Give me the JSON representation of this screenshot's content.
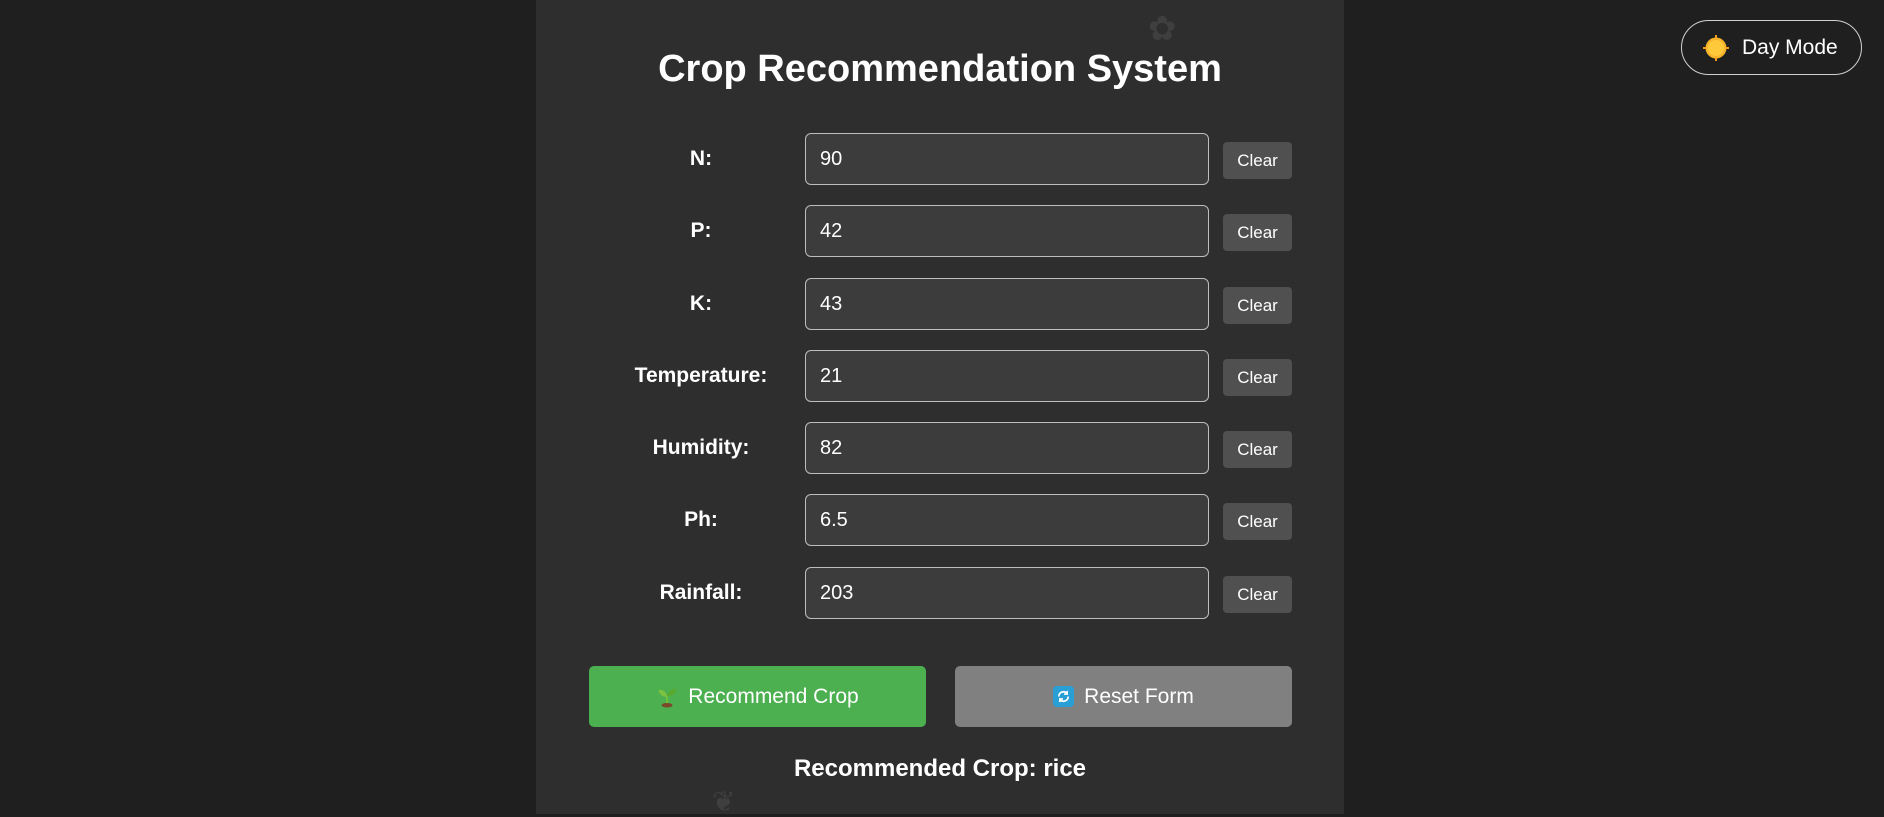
{
  "header": {
    "title": "Crop Recommendation System"
  },
  "fields": [
    {
      "label": "N:",
      "value": "90",
      "clear_label": "Clear"
    },
    {
      "label": "P:",
      "value": "42",
      "clear_label": "Clear"
    },
    {
      "label": "K:",
      "value": "43",
      "clear_label": "Clear"
    },
    {
      "label": "Temperature:",
      "value": "21",
      "clear_label": "Clear"
    },
    {
      "label": "Humidity:",
      "value": "82",
      "clear_label": "Clear"
    },
    {
      "label": "Ph:",
      "value": "6.5",
      "clear_label": "Clear"
    },
    {
      "label": "Rainfall:",
      "value": "203",
      "clear_label": "Clear"
    }
  ],
  "actions": {
    "recommend_label": "Recommend Crop",
    "recommend_icon": "sprout-icon",
    "reset_label": "Reset Form",
    "reset_icon": "refresh-icon"
  },
  "result": {
    "text": "Recommended Crop: rice"
  },
  "theme_toggle": {
    "label": "Day Mode",
    "icon": "sun-icon"
  },
  "colors": {
    "page_background": "#1f1f1f",
    "card_background": "#2e2e2e",
    "recommend_button": "#4caf50",
    "reset_button": "#808080",
    "clear_button": "#505050"
  }
}
